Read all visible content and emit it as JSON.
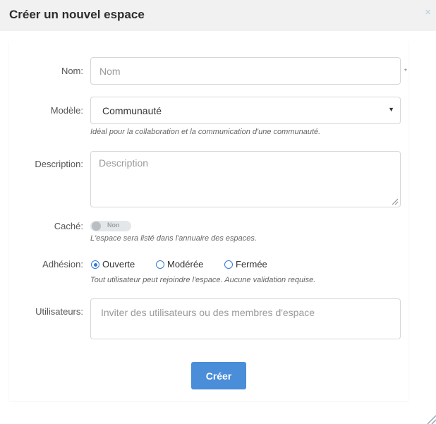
{
  "modal": {
    "title": "Créer un nouvel espace",
    "close_glyph": "×"
  },
  "form": {
    "name": {
      "label": "Nom:",
      "placeholder": "Nom",
      "required_mark": "*"
    },
    "template": {
      "label": "Modèle:",
      "selected": "Communauté",
      "hint": "Idéal pour la collaboration et la communication d'une communauté."
    },
    "description": {
      "label": "Description:",
      "placeholder": "Description"
    },
    "hidden": {
      "label": "Caché:",
      "toggle_text": "Non",
      "checked": false,
      "hint": "L'espace sera listé dans l'annuaire des espaces."
    },
    "membership": {
      "label": "Adhésion:",
      "options": [
        "Ouverte",
        "Modérée",
        "Fermée"
      ],
      "selected": "Ouverte",
      "hint": "Tout utilisateur peut rejoindre l'espace. Aucune validation requise."
    },
    "users": {
      "label": "Utilisateurs:",
      "placeholder": "Inviter des utilisateurs ou des membres d'espace"
    },
    "submit_label": "Créer"
  },
  "colors": {
    "accent": "#4a8dd8",
    "radio": "#2f7bd7",
    "header_bg": "#f1f1f1"
  },
  "icons": {
    "close": "close-icon",
    "dropdown": "caret-down-icon",
    "resize": "resize-grip-icon"
  }
}
